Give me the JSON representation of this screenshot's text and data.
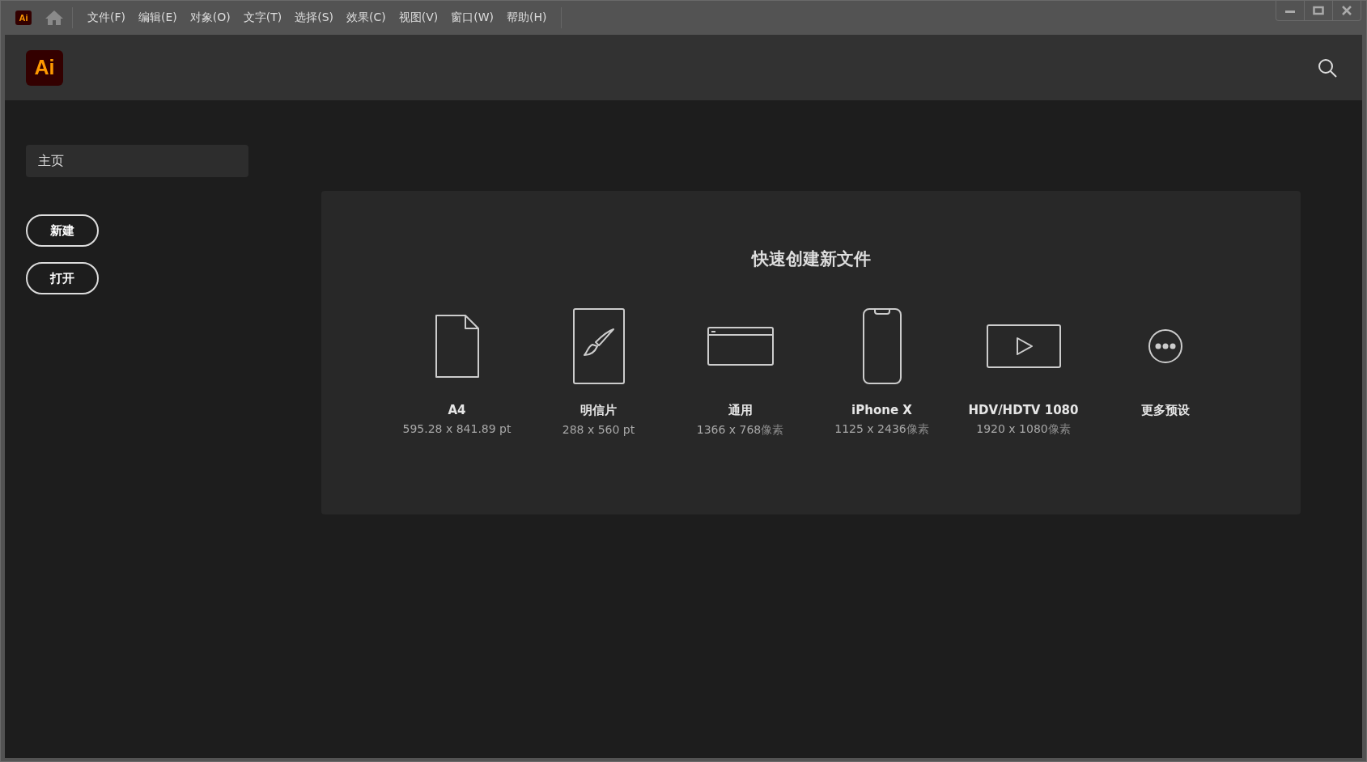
{
  "app": {
    "badge": "Ai",
    "logo": "Ai"
  },
  "menu": [
    "文件(F)",
    "编辑(E)",
    "对象(O)",
    "文字(T)",
    "选择(S)",
    "效果(C)",
    "视图(V)",
    "窗口(W)",
    "帮助(H)"
  ],
  "sidebar": {
    "home": "主页",
    "buttons": [
      "新建",
      "打开"
    ]
  },
  "quick_create": {
    "title": "快速创建新文件",
    "presets": [
      {
        "kind": "document",
        "name": "A4",
        "size": "595.28 x 841.89 pt"
      },
      {
        "kind": "postcard",
        "name": "明信片",
        "size": "288 x 560 pt"
      },
      {
        "kind": "web",
        "name": "通用",
        "size": "1366 x 768",
        "unit": "像素"
      },
      {
        "kind": "phone",
        "name": "iPhone X",
        "size": "1125 x 2436",
        "unit": "像素"
      },
      {
        "kind": "video",
        "name": "HDV/HDTV 1080",
        "size": "1920 x 1080",
        "unit": "像素"
      },
      {
        "kind": "more",
        "name": "更多预设"
      }
    ]
  }
}
